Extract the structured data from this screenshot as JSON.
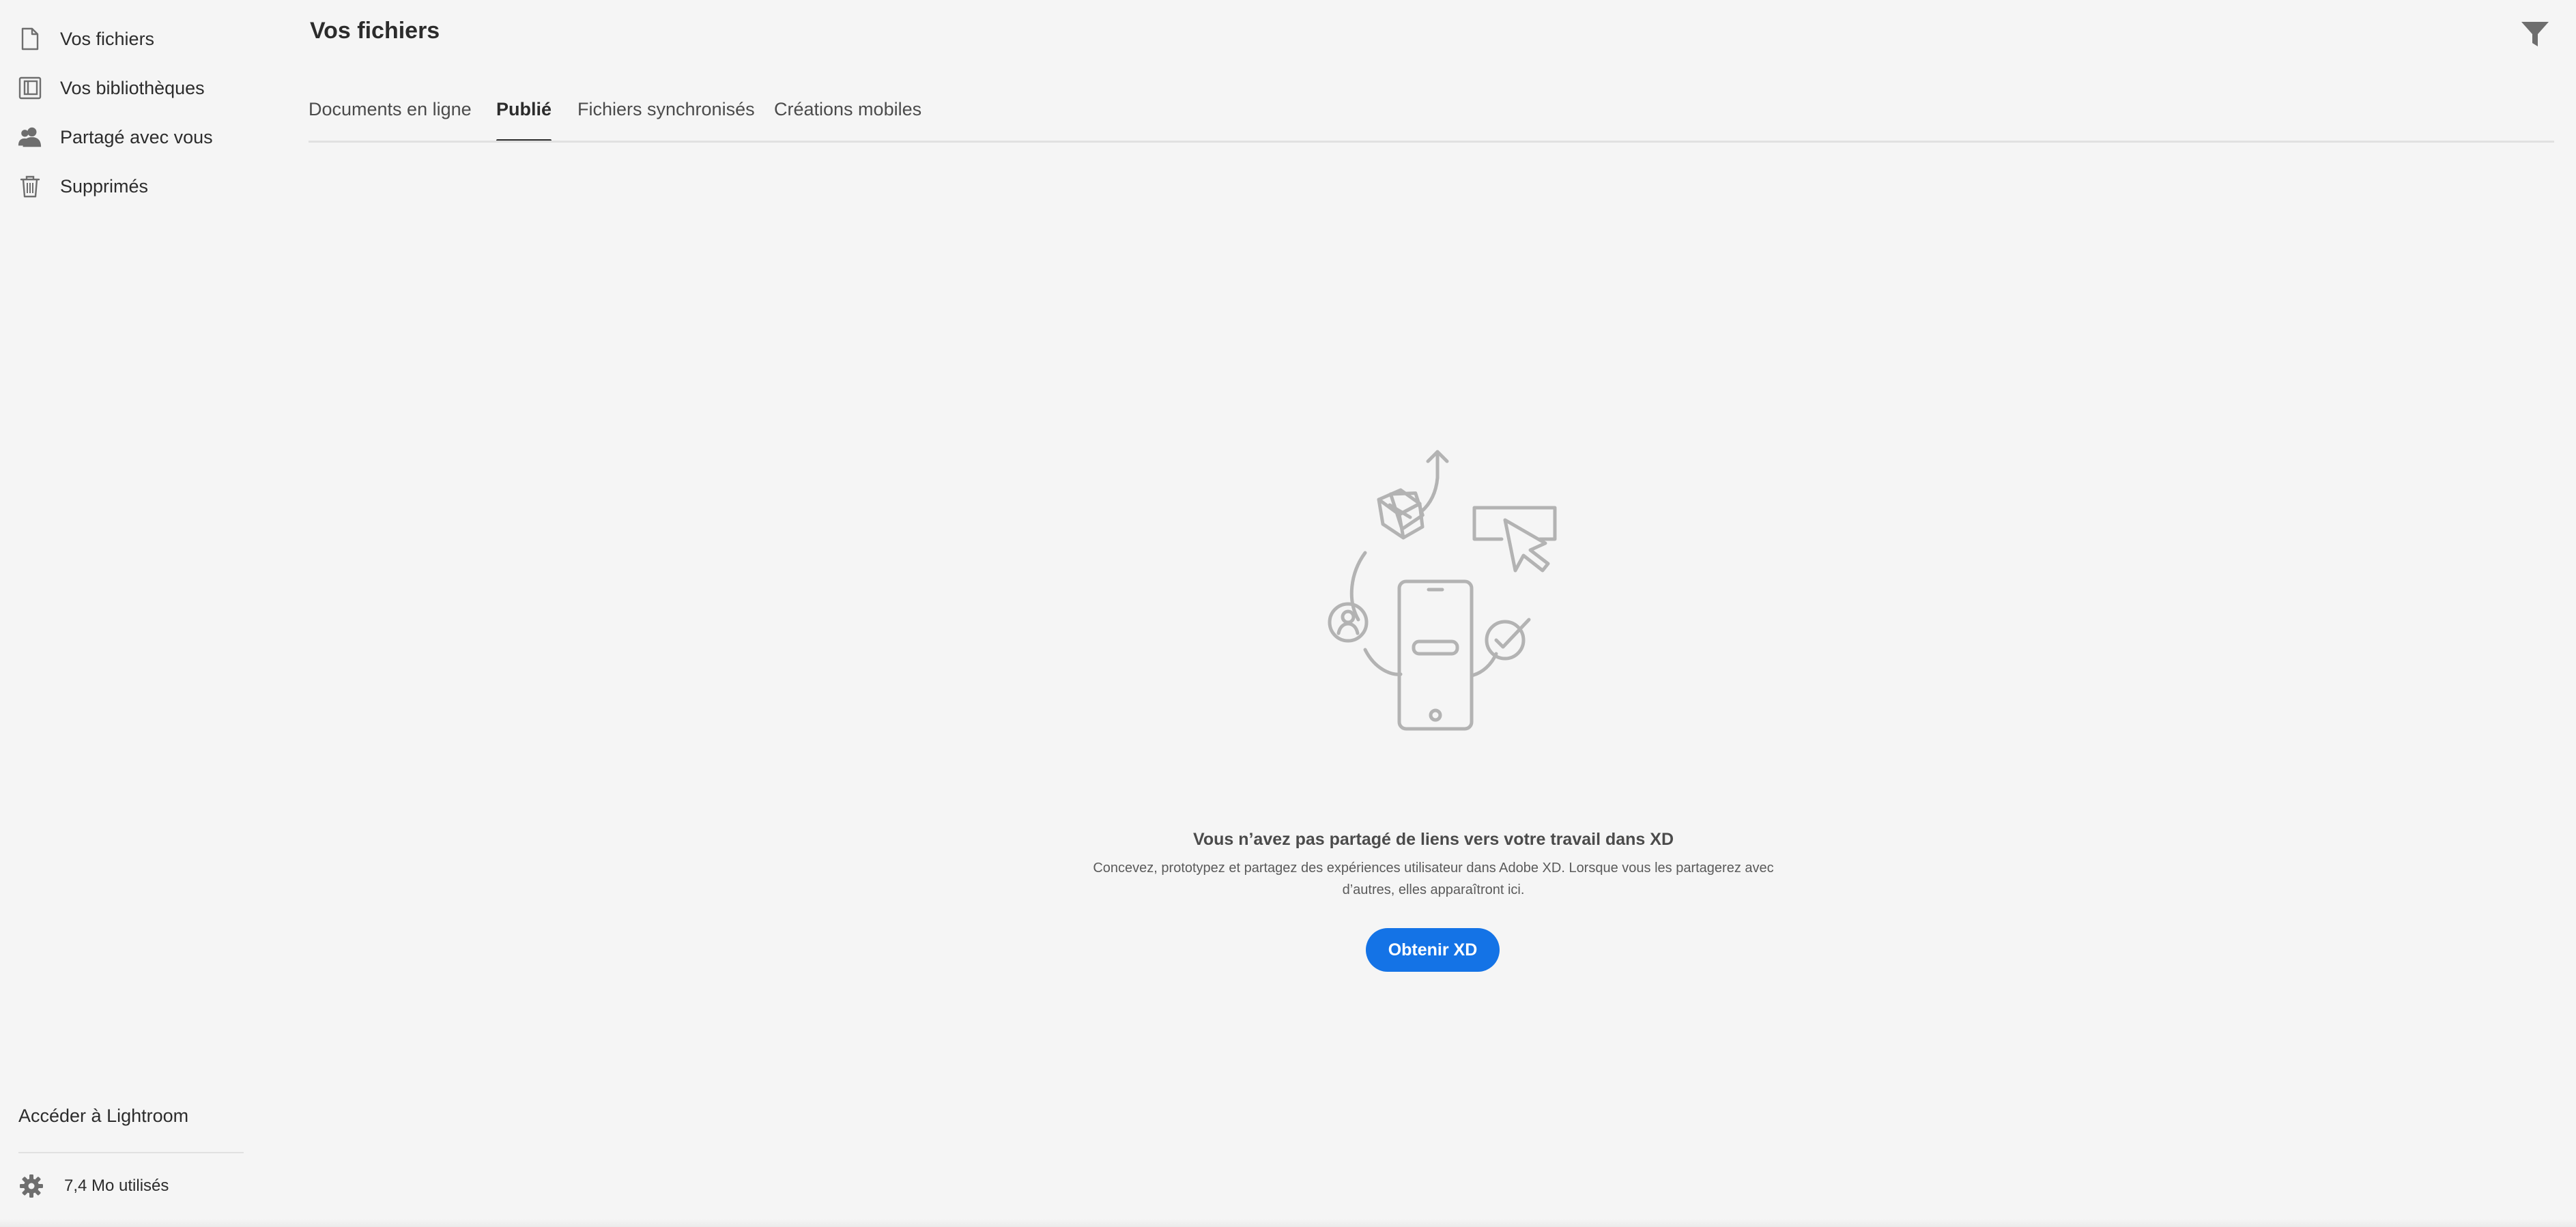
{
  "header": {
    "title": "Vos fichiers"
  },
  "sidebar": {
    "items": [
      {
        "label": "Vos fichiers",
        "icon": "document-icon"
      },
      {
        "label": "Vos bibliothèques",
        "icon": "library-icon"
      },
      {
        "label": "Partagé avec vous",
        "icon": "people-icon"
      },
      {
        "label": "Supprimés",
        "icon": "trash-icon"
      }
    ],
    "lightroom_link": "Accéder à Lightroom",
    "storage_label": "7,4 Mo utilisés"
  },
  "tabs": [
    {
      "label": "Documents en ligne",
      "active": false
    },
    {
      "label": "Publié",
      "active": true
    },
    {
      "label": "Fichiers synchronisés",
      "active": false
    },
    {
      "label": "Créations mobiles",
      "active": false
    }
  ],
  "empty_state": {
    "title": "Vous n’avez pas partagé de liens vers votre travail dans XD",
    "description_line1": "Concevez, prototypez et partagez des expériences utilisateur dans Adobe XD. Lorsque vous les partagerez avec",
    "description_line2": "d’autres, elles apparaîtront ici.",
    "cta_label": "Obtenir XD"
  },
  "colors": {
    "background": "#f5f5f5",
    "accent": "#1473e6",
    "text": "#2c2c2c",
    "icon": "#6e6e6e",
    "illustration": "#b3b3b3"
  }
}
